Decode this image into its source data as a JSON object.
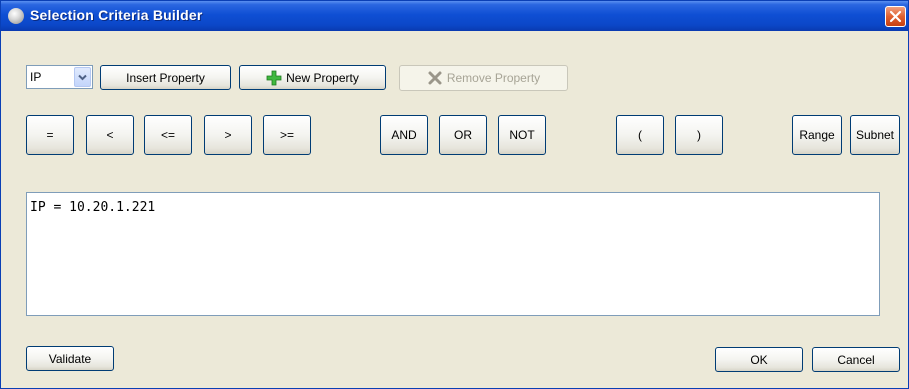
{
  "window": {
    "title": "Selection Criteria Builder"
  },
  "toolbar": {
    "property_select": {
      "value": "IP"
    },
    "insert_property": "Insert Property",
    "new_property": "New Property",
    "remove_property": "Remove Property"
  },
  "operators": {
    "eq": "=",
    "lt": "<",
    "le": "<=",
    "gt": ">",
    "ge": ">=",
    "and": "AND",
    "or": "OR",
    "not": "NOT",
    "lparen": "(",
    "rparen": ")",
    "range": "Range",
    "subnet": "Subnet"
  },
  "criteria": {
    "text": "IP = 10.20.1.221"
  },
  "footer": {
    "validate": "Validate",
    "ok": "OK",
    "cancel": "Cancel"
  },
  "colors": {
    "titlebar": "#0b47c8",
    "dialog_bg": "#ece9d8",
    "button_border": "#003c74",
    "new_icon": "#3fb83f",
    "close": "#e06030"
  }
}
